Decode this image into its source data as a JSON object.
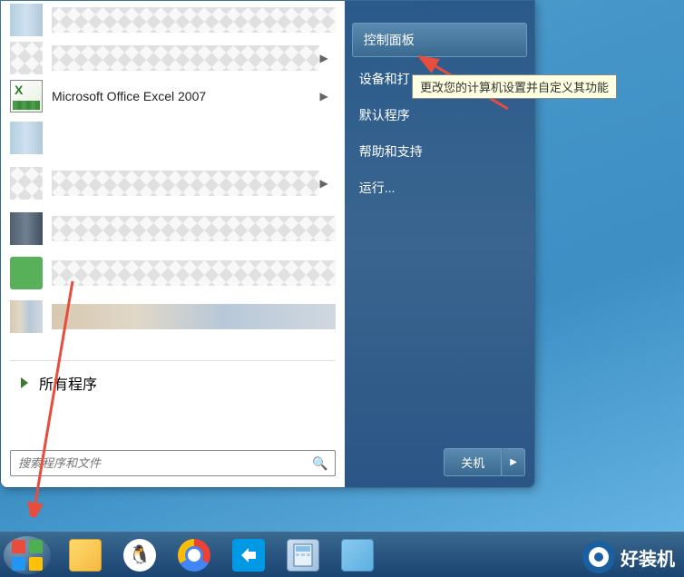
{
  "start_menu": {
    "programs": {
      "excel_label": "Microsoft Office Excel 2007",
      "all_programs_label": "所有程序"
    },
    "search": {
      "placeholder": "搜索程序和文件"
    },
    "right_panel": {
      "control_panel": "控制面板",
      "devices": "设备和打",
      "default_programs": "默认程序",
      "help_support": "帮助和支持",
      "run": "运行...",
      "shutdown": "关机"
    }
  },
  "tooltip": {
    "control_panel_tip": "更改您的计算机设置并自定义其功能"
  },
  "watermark": {
    "text": "好装机"
  }
}
